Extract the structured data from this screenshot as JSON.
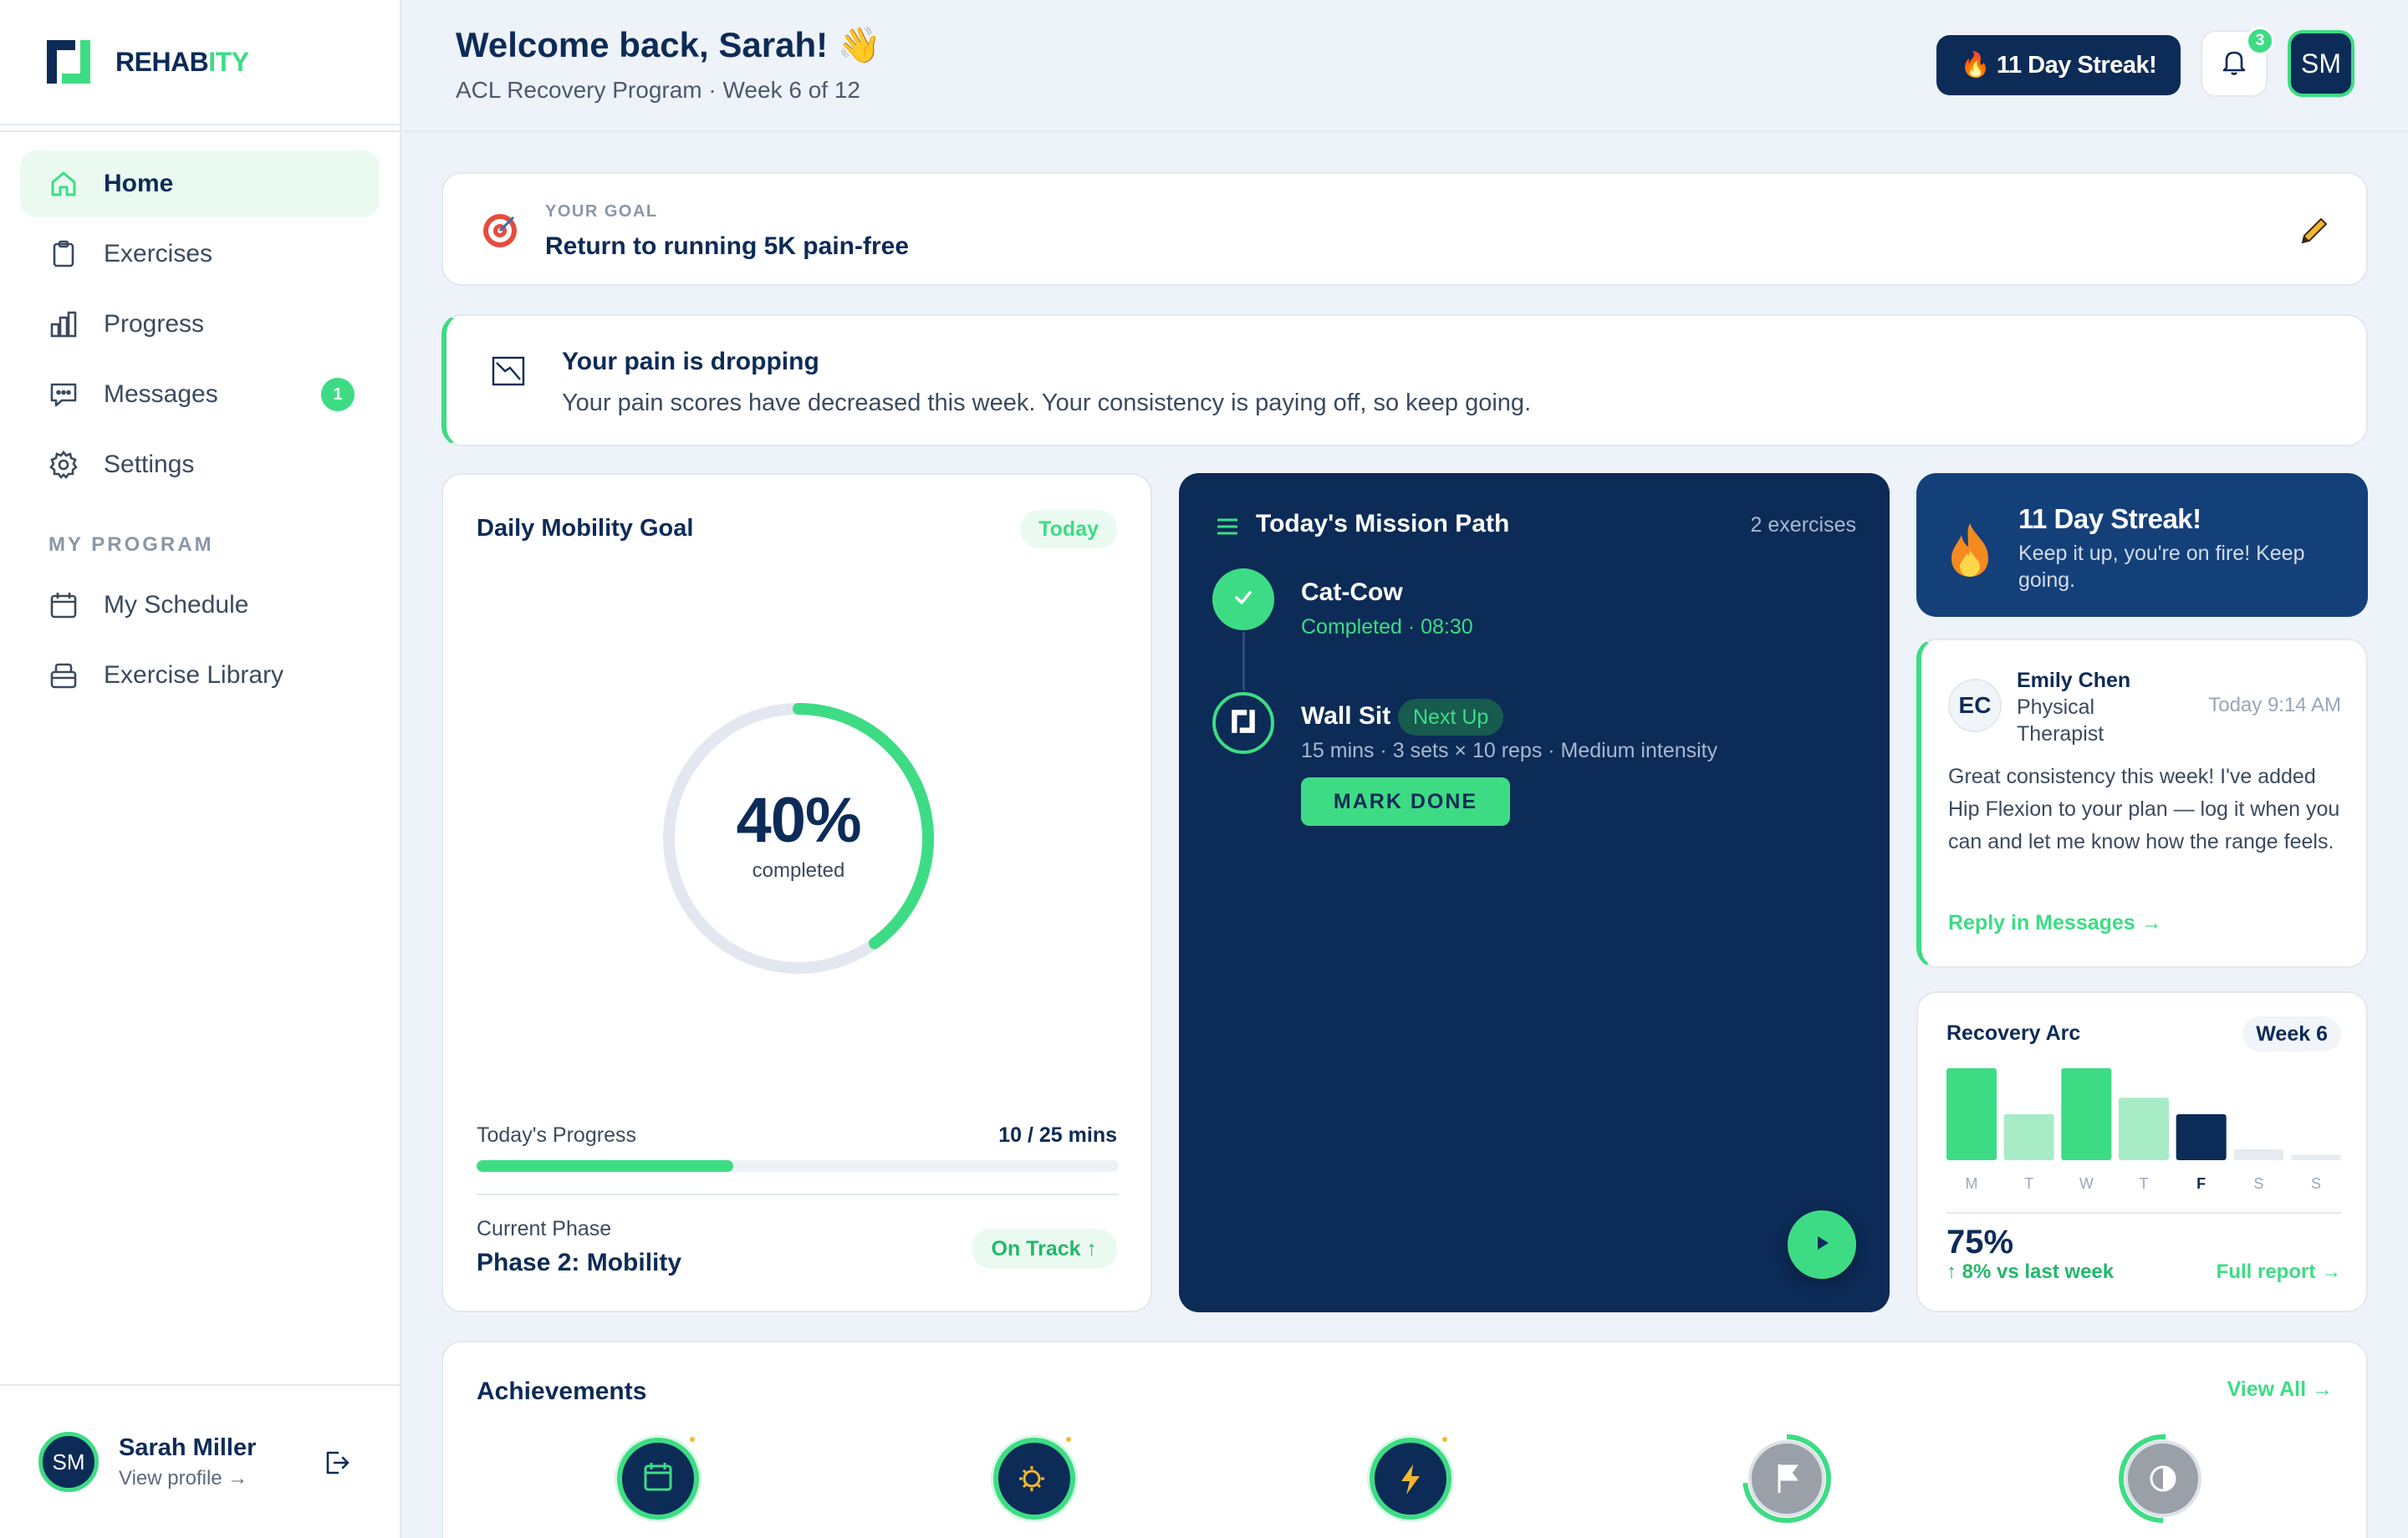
{
  "app": {
    "name_a": "REHAB",
    "name_b": "ITY"
  },
  "sidebar": {
    "items": [
      {
        "label": "Home",
        "icon": "home-icon"
      },
      {
        "label": "Exercises",
        "icon": "clipboard-icon"
      },
      {
        "label": "Progress",
        "icon": "bar-chart-icon"
      },
      {
        "label": "Messages",
        "icon": "message-icon",
        "badge": "1"
      },
      {
        "label": "Settings",
        "icon": "gear-icon"
      }
    ],
    "section_label": "MY PROGRAM",
    "program_items": [
      {
        "label": "My Schedule",
        "icon": "calendar-icon"
      },
      {
        "label": "Exercise Library",
        "icon": "library-icon"
      }
    ],
    "user": {
      "initials": "SM",
      "name": "Sarah Miller",
      "link": "View profile →"
    }
  },
  "header": {
    "welcome": "Welcome back, Sarah! 👋",
    "subtitle": "ACL Recovery Program · Week 6 of 12",
    "streak": "🔥 11 Day Streak!",
    "notifications_count": "3",
    "avatar_initials": "SM"
  },
  "goal": {
    "label": "YOUR GOAL",
    "text": "Return to running 5K pain-free"
  },
  "insight": {
    "title": "Your pain is dropping",
    "body": "Your pain scores have decreased this week. Your consistency is paying off, so keep going."
  },
  "mobility": {
    "title": "Daily Mobility Goal",
    "tag": "Today",
    "percent_label": "40%",
    "percent": 0.4,
    "completed_label": "completed",
    "progress_label": "Today's Progress",
    "progress_value": "10 / 25 mins",
    "progress_fraction": 0.4,
    "phase_label": "Current Phase",
    "phase_value": "Phase 2: Mobility",
    "status": "On Track ↑"
  },
  "mission": {
    "title": "Today's Mission Path",
    "count": "2 exercises",
    "steps": [
      {
        "name": "Cat-Cow",
        "status": "Completed · 08:30"
      },
      {
        "name": "Wall Sit",
        "tag": "Next Up",
        "meta": "15 mins · 3 sets × 10 reps · Medium intensity",
        "action": "MARK DONE"
      }
    ]
  },
  "streak_card": {
    "title": "11 Day Streak!",
    "body": "Keep it up, you're on fire! Keep going."
  },
  "message": {
    "initials": "EC",
    "name": "Emily Chen",
    "role": "Physical Therapist",
    "time": "Today 9:14 AM",
    "body": "Great consistency this week! I've added Hip Flexion to your plan — log it when you can and let me know how the range feels.",
    "reply": "Reply in Messages →"
  },
  "recovery": {
    "title": "Recovery Arc",
    "week": "Week 6",
    "percent": "75%",
    "delta": "↑ 8% vs last week",
    "link": "Full report →"
  },
  "chart_data": {
    "type": "bar",
    "categories": [
      "M",
      "T",
      "W",
      "T",
      "F",
      "S",
      "S"
    ],
    "values": [
      100,
      50,
      100,
      68,
      50,
      12,
      6
    ],
    "highlight": "F",
    "ylim": [
      0,
      100
    ]
  },
  "achievements": {
    "title": "Achievements",
    "view_all": "View All →",
    "badges": [
      {
        "icon": "calendar-icon",
        "unlocked": true
      },
      {
        "icon": "sun-icon",
        "unlocked": true
      },
      {
        "icon": "lightning-icon",
        "unlocked": true
      },
      {
        "icon": "flag-icon",
        "unlocked": false
      },
      {
        "icon": "half-circle-icon",
        "unlocked": false
      }
    ]
  },
  "colors": {
    "navy": "#0c2b57",
    "accent": "#3ddc84",
    "background": "#eef2f9"
  }
}
